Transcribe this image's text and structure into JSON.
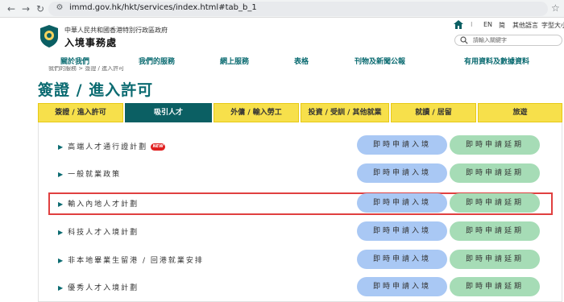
{
  "browser": {
    "back": "←",
    "forward": "→",
    "reload": "↻",
    "url": "immd.gov.hk/hkt/services/index.html#tab_b_1"
  },
  "header": {
    "gov_name": "中華人民共和國香港特別行政區政府",
    "dept_name": "入境事務處",
    "utility": {
      "en": "EN",
      "simplified": "简",
      "other_languages": "其他語言",
      "font_size": "字型大小"
    },
    "search_placeholder": "請輸入關鍵字"
  },
  "main_nav": [
    "關於我們",
    "我們的服務",
    "網上服務",
    "表格",
    "刊物及新聞公報",
    "有用資料及數據資料"
  ],
  "breadcrumb": "我們的服務 > 簽證 / 進入許可",
  "page_title": "簽證 / 進入許可",
  "tabs": [
    {
      "label": "簽證 / 進入許可",
      "active": false
    },
    {
      "label": "吸引人才",
      "active": true
    },
    {
      "label": "外傭 / 輸入勞工",
      "active": false
    },
    {
      "label": "投資 / 受訓 / 其他就業",
      "active": false
    },
    {
      "label": "就讀 / 居留",
      "active": false
    },
    {
      "label": "旅遊",
      "active": false
    }
  ],
  "rows": [
    {
      "label": "高端人才通行證計劃",
      "new_badge": "NEW"
    },
    {
      "label": "一般就業政策"
    },
    {
      "label": "輸入內地人才計劃",
      "highlighted": true
    },
    {
      "label": "科技人才入境計劃"
    },
    {
      "label": "非本地畢業生留港 / 回港就業安排"
    },
    {
      "label": "優秀人才入境計劃"
    }
  ],
  "buttons": {
    "entry": "即時申請入境",
    "extend": "即時申請延期"
  },
  "colors": {
    "brand_teal": "#0b6b71",
    "tab_yellow": "#f7e04b",
    "entry_button": "#a9c8f4",
    "extend_button": "#a6dcb6",
    "highlight_red": "#e04040"
  }
}
